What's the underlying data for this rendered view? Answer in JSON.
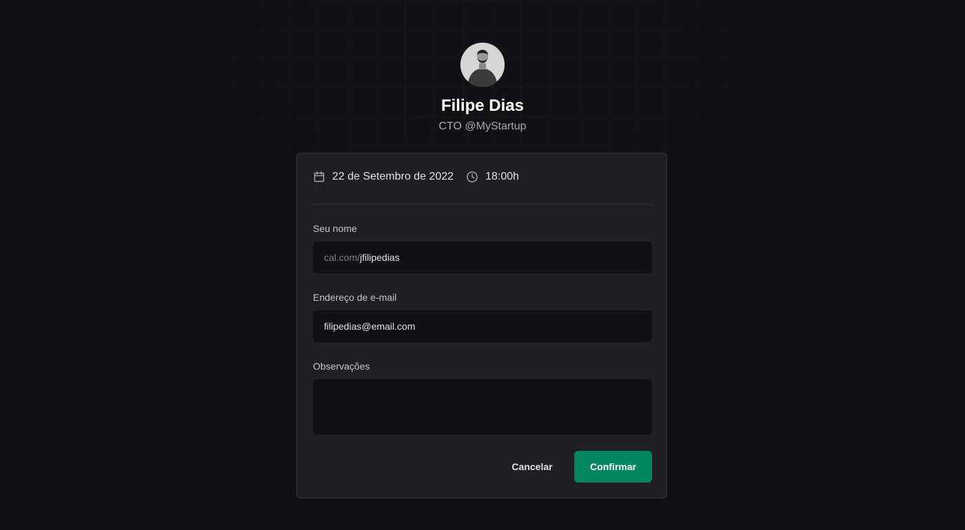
{
  "profile": {
    "name": "Filipe Dias",
    "bio": "CTO @MyStartup"
  },
  "schedule": {
    "date": "22 de Setembro de 2022",
    "time": "18:00h",
    "date_icon": "calendar-icon",
    "time_icon": "clock-icon"
  },
  "form": {
    "username": {
      "label": "Seu nome",
      "prefix": "cal.com/",
      "value": "jfilipedias"
    },
    "email": {
      "label": "Endereço de e-mail",
      "value": "filipedias@email.com"
    },
    "notes": {
      "label": "Observações",
      "value": ""
    }
  },
  "actions": {
    "cancel_label": "Cancelar",
    "confirm_label": "Confirmar"
  },
  "colors": {
    "background": "#121214",
    "card": "#202024",
    "input": "#121214",
    "accent": "#00875f"
  }
}
